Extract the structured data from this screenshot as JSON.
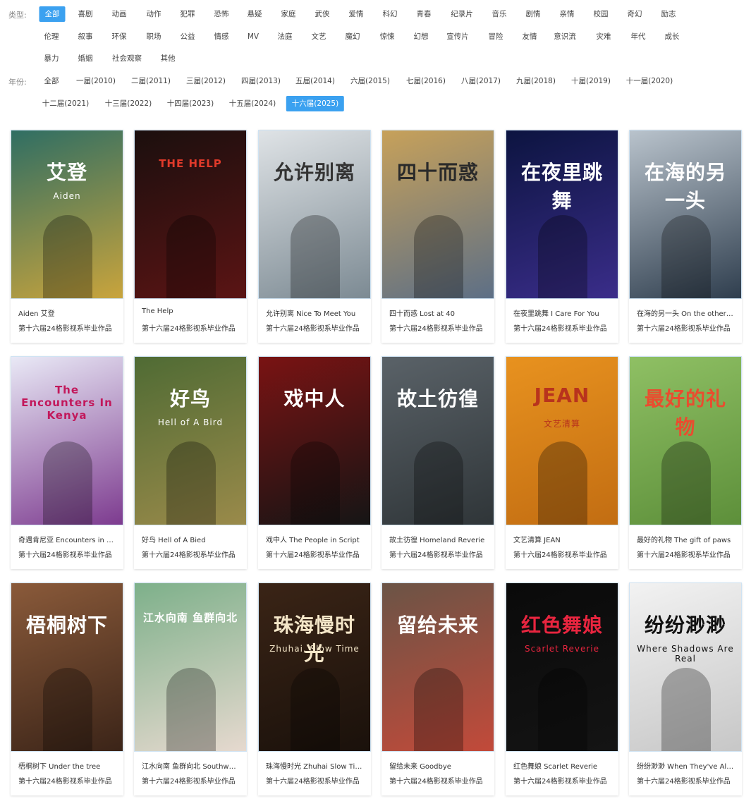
{
  "filters": {
    "type_label": "类型:",
    "year_label": "年份:",
    "types_row1": [
      "全部",
      "喜剧",
      "动画",
      "动作",
      "犯罪",
      "恐怖",
      "悬疑",
      "家庭",
      "武侠",
      "爱情",
      "科幻",
      "青春",
      "纪录片",
      "音乐",
      "剧情",
      "亲情",
      "校园",
      "奇幻",
      "励志"
    ],
    "types_row2": [
      "伦理",
      "叙事",
      "环保",
      "职场",
      "公益",
      "情感",
      "MV",
      "法庭",
      "文艺",
      "魔幻",
      "惊悚",
      "幻想",
      "宣传片",
      "冒险",
      "友情",
      "意识流",
      "灾难",
      "年代",
      "成长"
    ],
    "types_row3": [
      "暴力",
      "婚姻",
      "社会观察",
      "其他"
    ],
    "years_row1": [
      "全部",
      "一届(2010)",
      "二届(2011)",
      "三届(2012)",
      "四届(2013)",
      "五届(2014)",
      "六届(2015)",
      "七届(2016)",
      "八届(2017)",
      "九届(2018)",
      "十届(2019)",
      "十一届(2020)"
    ],
    "years_row2": [
      "十二届(2021)",
      "十三届(2022)",
      "十四届(2023)",
      "十五届(2024)",
      "十六届(2025)"
    ],
    "active_type": "全部",
    "active_year": "十六届(2025)"
  },
  "films": [
    {
      "title": "Aiden 艾登",
      "subtitle": "第十六届24格影视系毕业作品",
      "poster_text": "艾登",
      "poster_en": "Aiden",
      "c1": "#2f6e63",
      "c2": "#c9a43c",
      "fg": "#ffffff"
    },
    {
      "title": "The Help",
      "subtitle": "第十六届24格影视系毕业作品",
      "poster_text": "THE HELP",
      "poster_en": "",
      "c1": "#1b0f0e",
      "c2": "#5b1414",
      "fg": "#e03a2a"
    },
    {
      "title": "允许别离 Nice To Meet You",
      "subtitle": "第十六届24格影视系毕业作品",
      "poster_text": "允许别离",
      "poster_en": "",
      "c1": "#dfe3e6",
      "c2": "#7c8a93",
      "fg": "#333333"
    },
    {
      "title": "四十而惑 Lost at 40",
      "subtitle": "第十六届24格影视系毕业作品",
      "poster_text": "四十而惑",
      "poster_en": "",
      "c1": "#c7a15a",
      "c2": "#5d6f86",
      "fg": "#2a2a2a"
    },
    {
      "title": "在夜里跳舞 I Care For You",
      "subtitle": "第十六届24格影视系毕业作品",
      "poster_text": "在夜里跳舞",
      "poster_en": "",
      "c1": "#0c1440",
      "c2": "#3a2d8a",
      "fg": "#ffffff"
    },
    {
      "title": "在海的另一头 On the other side of the sea",
      "subtitle": "第十六届24格影视系毕业作品",
      "poster_text": "在海的另一头",
      "poster_en": "",
      "c1": "#b9c3cc",
      "c2": "#2f3e4e",
      "fg": "#ffffff"
    },
    {
      "title": "奇遇肯尼亚 Encounters in Kenya",
      "subtitle": "第十六届24格影视系毕业作品",
      "poster_text": "The Encounters In Kenya",
      "poster_en": "",
      "c1": "#e9e9f6",
      "c2": "#7d3b8f",
      "fg": "#c2185b"
    },
    {
      "title": "好鸟 Hell of A Bied",
      "subtitle": "第十六届24格影视系毕业作品",
      "poster_text": "好鸟",
      "poster_en": "Hell of A Bird",
      "c1": "#4f6b34",
      "c2": "#9a8a4a",
      "fg": "#ffffff"
    },
    {
      "title": "戏中人 The People in Script",
      "subtitle": "第十六届24格影视系毕业作品",
      "poster_text": "戏中人",
      "poster_en": "",
      "c1": "#7a1313",
      "c2": "#151515",
      "fg": "#ffffff"
    },
    {
      "title": "故土彷徨 Homeland Reverie",
      "subtitle": "第十六届24格影视系毕业作品",
      "poster_text": "故土彷徨",
      "poster_en": "",
      "c1": "#5a6268",
      "c2": "#2f3538",
      "fg": "#ffffff"
    },
    {
      "title": "文艺清算 JEAN",
      "subtitle": "第十六届24格影视系毕业作品",
      "poster_text": "JEAN",
      "poster_en": "文艺清算",
      "c1": "#e8921f",
      "c2": "#c26d12",
      "fg": "#b8331d"
    },
    {
      "title": "最好的礼物 The gift of paws",
      "subtitle": "第十六届24格影视系毕业作品",
      "poster_text": "最好的礼物",
      "poster_en": "",
      "c1": "#8fc064",
      "c2": "#5d8f3a",
      "fg": "#e94d2f"
    },
    {
      "title": "梧桐树下 Under the tree",
      "subtitle": "第十六届24格影视系毕业作品",
      "poster_text": "梧桐树下",
      "poster_en": "",
      "c1": "#8a5a3a",
      "c2": "#3b2418",
      "fg": "#ffffff"
    },
    {
      "title": "江水向南 鱼群向北 Southward River, Northward Fish",
      "subtitle": "第十六届24格影视系毕业作品",
      "poster_text": "江水向南 鱼群向北",
      "poster_en": "",
      "c1": "#7db08a",
      "c2": "#e6d9cf",
      "fg": "#ffffff"
    },
    {
      "title": "珠海慢时光 Zhuhai Slow Time",
      "subtitle": "第十六届24格影视系毕业作品",
      "poster_text": "珠海慢时光",
      "poster_en": "Zhuhai, Slow Time",
      "c1": "#3a2416",
      "c2": "#1a110b",
      "fg": "#f4e6c8"
    },
    {
      "title": "留给未来 Goodbye",
      "subtitle": "第十六届24格影视系毕业作品",
      "poster_text": "留给未来",
      "poster_en": "",
      "c1": "#6b5446",
      "c2": "#c24a3a",
      "fg": "#ffffff"
    },
    {
      "title": "红色舞娘 Scarlet Reverie",
      "subtitle": "第十六届24格影视系毕业作品",
      "poster_text": "红色舞娘",
      "poster_en": "Scarlet Reverie",
      "c1": "#0a0a0a",
      "c2": "#141414",
      "fg": "#e8253f"
    },
    {
      "title": "纷纷渺渺 When They've All Fallen Apart",
      "subtitle": "第十六届24格影视系毕业作品",
      "poster_text": "纷纷渺渺",
      "poster_en": "Where Shadows Are Real",
      "c1": "#f2f2f2",
      "c2": "#c7c7c7",
      "fg": "#111111"
    }
  ]
}
